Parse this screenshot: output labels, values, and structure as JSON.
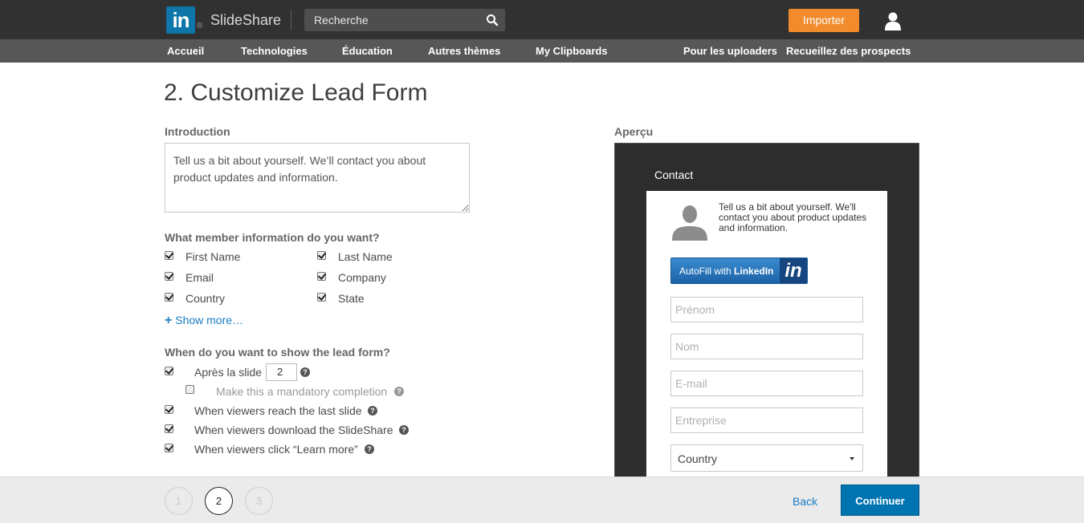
{
  "header": {
    "logo_text": "in",
    "logo_reg": "®",
    "brand": "SlideShare",
    "search_placeholder": "Recherche",
    "import_label": "Importer"
  },
  "nav": {
    "items": [
      "Accueil",
      "Technologies",
      "Éducation",
      "Autres thèmes",
      "My Clipboards"
    ],
    "right_items": [
      "Pour les uploaders",
      "Recueillez des prospects"
    ]
  },
  "main": {
    "title": "2. Customize Lead Form",
    "intro_label": "Introduction",
    "intro_text": "Tell us a bit about yourself. We’ll contact you about product updates and information.",
    "member_label": "What member information do you want?",
    "member_fields": [
      {
        "label": "First Name",
        "checked": true
      },
      {
        "label": "Last Name",
        "checked": true
      },
      {
        "label": "Email",
        "checked": true
      },
      {
        "label": "Company",
        "checked": true
      },
      {
        "label": "Country",
        "checked": true
      },
      {
        "label": "State",
        "checked": true
      }
    ],
    "show_more": "Show more…",
    "when_label": "When do you want to show the lead form?",
    "after_slide_label": "Après la slide",
    "after_slide_value": "2",
    "mandatory_label": "Make this a mandatory completion",
    "last_slide_label": "When viewers reach the last slide",
    "download_label": "When viewers download the SlideShare",
    "learn_more_label": "When viewers click “Learn more”"
  },
  "preview": {
    "label": "Aperçu",
    "title": "Contact",
    "intro": "Tell us a bit about yourself. We'll contact you about product updates and information.",
    "autofill_prefix": "AutoFill with",
    "autofill_brand": "LinkedIn",
    "autofill_in": "in",
    "placeholders": [
      "Prénom",
      "Nom",
      "E-mail",
      "Entreprise"
    ],
    "country_label": "Country"
  },
  "footer": {
    "steps": [
      "1",
      "2",
      "3"
    ],
    "active_step": "2",
    "back_label": "Back",
    "continue_label": "Continuer"
  },
  "colors": {
    "topbar": "#313131",
    "navbar": "#575757",
    "accent_orange": "#f28b2b",
    "linkedin_blue": "#0e76a8",
    "primary_button": "#0073b1",
    "link": "#1a7cc4"
  }
}
